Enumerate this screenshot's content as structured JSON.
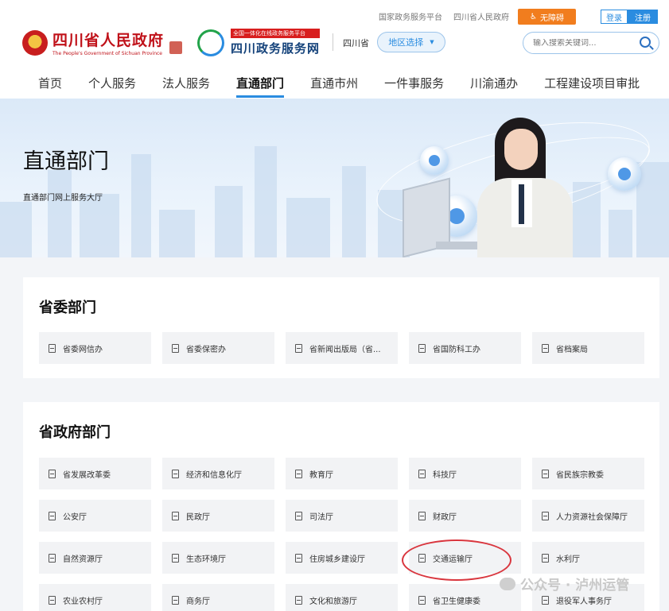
{
  "header": {
    "top_links": [
      "国家政务服务平台",
      "四川省人民政府"
    ],
    "accessibility_label": "无障碍",
    "login_label": "登录",
    "register_label": "注册",
    "gov_name": "四川省人民政府",
    "gov_name_en": "The People's Government of Sichuan Province",
    "portal_tagline": "全国一体化在线政务服务平台",
    "portal_name": "四川政务服务网",
    "province": "四川省",
    "region_select_label": "地区选择",
    "search_placeholder": "输入搜索关键词..."
  },
  "nav": {
    "items": [
      "首页",
      "个人服务",
      "法人服务",
      "直通部门",
      "直通市州",
      "一件事服务",
      "川渝通办",
      "工程建设项目审批"
    ],
    "active_index": 3
  },
  "banner": {
    "title": "直通部门",
    "subtitle": "直通部门网上服务大厅"
  },
  "sections": {
    "provincial_committee": {
      "title": "省委部门",
      "items": [
        "省委网信办",
        "省委保密办",
        "省新闻出版局（省...",
        "省国防科工办",
        "省档案局"
      ]
    },
    "provincial_government": {
      "title": "省政府部门",
      "items": [
        "省发展改革委",
        "经济和信息化厅",
        "教育厅",
        "科技厅",
        "省民族宗教委",
        "公安厅",
        "民政厅",
        "司法厅",
        "财政厅",
        "人力资源社会保障厅",
        "自然资源厅",
        "生态环境厅",
        "住房城乡建设厅",
        "交通运输厅",
        "水利厅",
        "农业农村厅",
        "商务厅",
        "文化和旅游厅",
        "省卫生健康委",
        "退役军人事务厅"
      ]
    }
  },
  "watermark": "公众号 · 泸州运管",
  "colors": {
    "primary_blue": "#2a8ce0",
    "accessibility_orange": "#f17d1e",
    "gov_red": "#c0121a",
    "highlight_red": "#d9363e"
  }
}
